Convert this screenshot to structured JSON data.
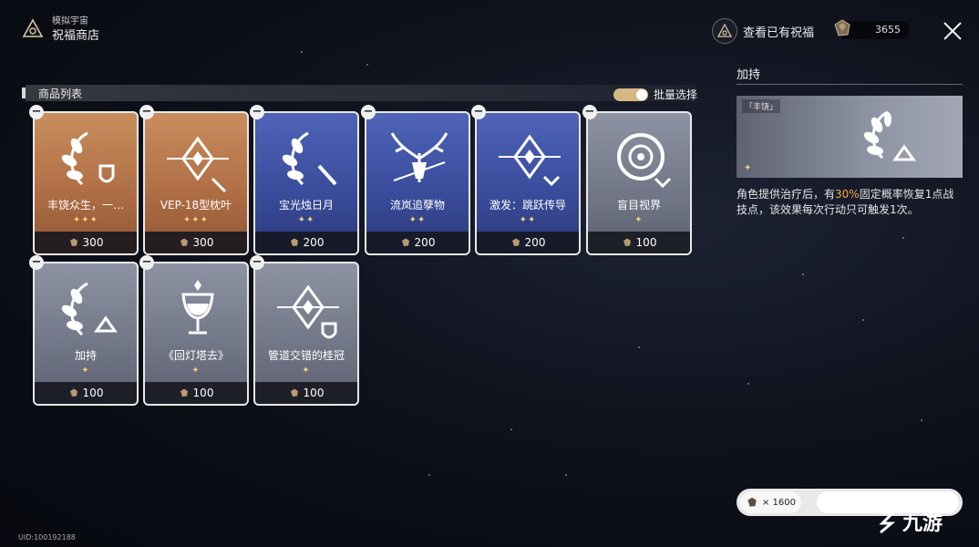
{
  "header": {
    "breadcrumb_sub": "模拟宇宙",
    "breadcrumb_title": "祝福商店",
    "view_blessings_label": "查看已有祝福",
    "currency_value": "3655"
  },
  "list": {
    "header_label": "商品列表",
    "batch_select_label": "批量选择",
    "batch_select_on": true
  },
  "items": [
    {
      "name": "丰饶众生，一…",
      "stars": "✦✦✦",
      "price": "300",
      "theme": "orange",
      "icon": "wheat-shield-icon"
    },
    {
      "name": "VEP-18型枕叶",
      "stars": "✦✦✦",
      "price": "300",
      "theme": "orange",
      "icon": "diamond-sword-icon"
    },
    {
      "name": "宝光烛日月",
      "stars": "✦✦",
      "price": "200",
      "theme": "blue",
      "icon": "wheat-sword-icon"
    },
    {
      "name": "流岚追孽物",
      "stars": "✦✦",
      "price": "200",
      "theme": "blue",
      "icon": "antler-icon"
    },
    {
      "name": "激发：跳跃传导",
      "stars": "✦✦",
      "price": "200",
      "theme": "blue",
      "icon": "diamond-chevron-icon"
    },
    {
      "name": "盲目视界",
      "stars": "✦",
      "price": "100",
      "theme": "gray",
      "icon": "eye-chevron-icon"
    },
    {
      "name": "加持",
      "stars": "✦",
      "price": "100",
      "theme": "gray",
      "icon": "wheat-arrow-icon"
    },
    {
      "name": "《回灯塔去》",
      "stars": "✦",
      "price": "100",
      "theme": "gray",
      "icon": "chalice-icon"
    },
    {
      "name": "管道交错的桂冠",
      "stars": "✦",
      "price": "100",
      "theme": "gray",
      "icon": "diamond-shield-icon"
    }
  ],
  "detail": {
    "title": "加持",
    "tag": "「丰饶」",
    "stars": "✦",
    "desc_before": "角色提供治疗后，有",
    "desc_highlight": "30%",
    "desc_after": "固定概率恢复1点战技点，该效果每次行动只可触发1次。",
    "highlight_color": "#f2a64a"
  },
  "balance": {
    "label": "× 1600"
  },
  "footer": {
    "uid": "UID:100192188",
    "watermark": "九游"
  }
}
